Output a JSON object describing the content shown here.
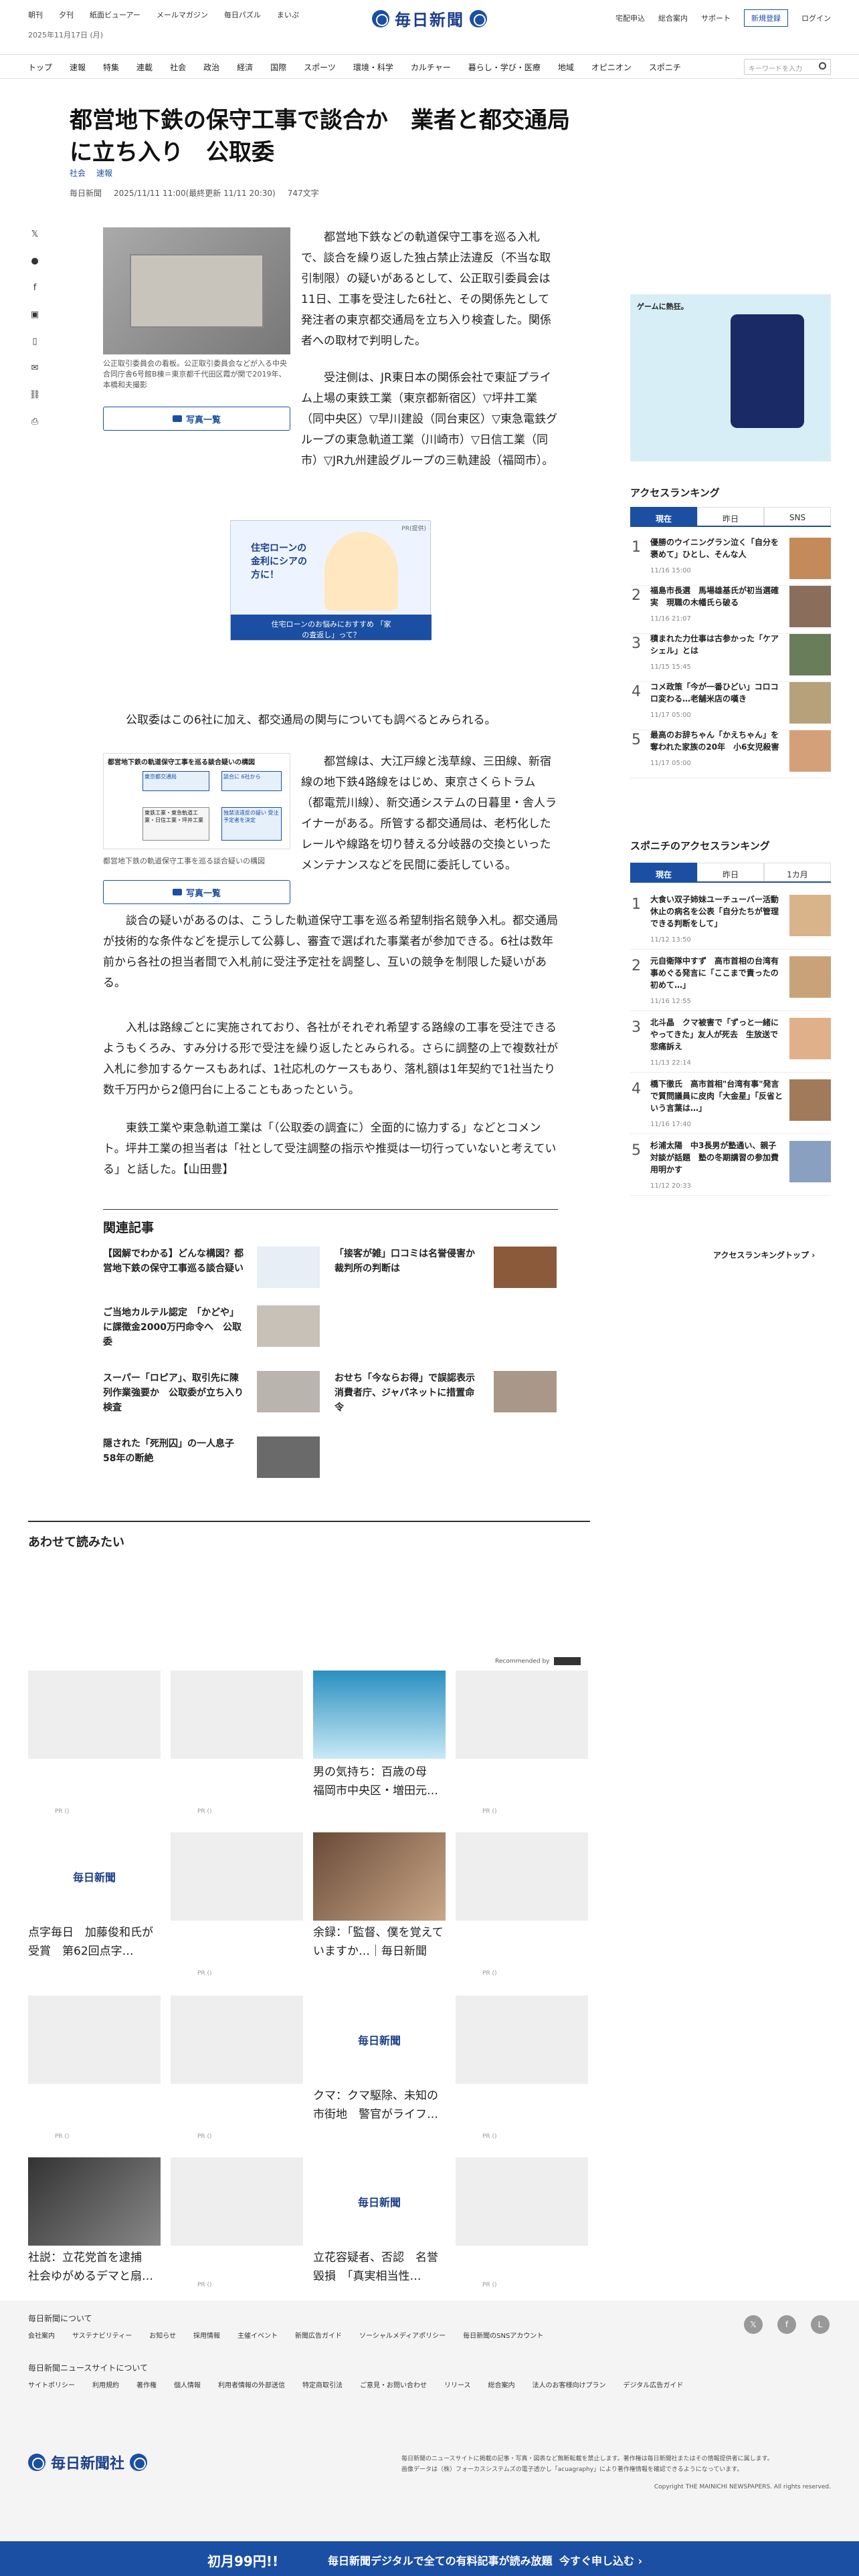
{
  "header": {
    "top_links": [
      "朝刊",
      "夕刊",
      "紙面ビューアー",
      "メールマガジン",
      "毎日パズル",
      "まいぷ"
    ],
    "date": "2025年11月17日 (月)",
    "logo_text": "毎日新聞",
    "right_links": [
      "宅配申込",
      "総合案内",
      "サポート"
    ],
    "register": "新規登録",
    "login": "ログイン"
  },
  "nav": {
    "items": [
      "トップ",
      "速報",
      "特集",
      "連載",
      "社会",
      "政治",
      "経済",
      "国際",
      "スポーツ",
      "環境・科学",
      "カルチャー",
      "暮らし・学び・医療",
      "地域",
      "オピニオン",
      "スポニチ"
    ],
    "search_placeholder": "キーワードを入力"
  },
  "article": {
    "title": "都営地下鉄の保守工事で談合か　業者と都交通局に立ち入り　公取委",
    "categories": [
      "社会",
      "速報"
    ],
    "source": "毎日新聞",
    "datetime": "2025/11/11 11:00(最終更新 11/11 20:30)",
    "chars": "747文字",
    "photo1_caption": "公正取引委員会の看板。公正取引委員会などが入る中央合同庁舎6号館B棟＝東京都千代田区霞が関で2019年、本橋和夫撮影",
    "photo_button": "写真一覧",
    "p1": "都営地下鉄などの軌道保守工事を巡る入札で、談合を繰り返した独占禁止法違反（不当な取引制限）の疑いがあるとして、公正取引委員会は11日、工事を受注した6社と、その関係先として発注者の東京都交通局を立ち入り検査した。関係者への取材で判明した。",
    "p2": "受注側は、JR東日本の関係会社で東証プライム上場の東鉄工業（東京都新宿区）▽坪井工業（同中央区）▽早川建設（同台東区）▽東急電鉄グループの東急軌道工業（川崎市）▽日信工業（同市）▽JR九州建設グループの三軌建設（福岡市）。",
    "promo_label": "PR(提供)",
    "promo_text": "住宅ローンの金利にシアの方に！",
    "promo_caption": "住宅ローンのお悩みにおすすめ 「家の査返し」って？",
    "p3": "公取委はこの6社に加え、都交通局の関与についても調べるとみられる。",
    "diagram_title": "都営地下鉄の軌道保守工事を巡る談合疑いの構図",
    "diagram_boxes": [
      "東京都交通局",
      "談合に 6社から",
      "東鉄工業・東急軌道工業・日信工業・坪井工業",
      "独禁法違反の疑い 受注予定者を決定"
    ],
    "photo2_caption": "都営地下鉄の軌道保守工事を巡る談合疑いの構図",
    "p4": "都営線は、大江戸線と浅草線、三田線、新宿線の地下鉄4路線をはじめ、東京さくらトラム（都電荒川線）、新交通システムの日暮里・舎人ライナーがある。所管する都交通局は、老朽化したレールや線路を切り替える分岐器の交換といったメンテナンスなどを民間に委託している。",
    "p5": "談合の疑いがあるのは、こうした軌道保守工事を巡る希望制指名競争入札。都交通局が技術的な条件などを提示して公募し、審査で選ばれた事業者が参加できる。6社は数年前から各社の担当者間で入札前に受注予定社を調整し、互いの競争を制限した疑いがある。",
    "p6": "入札は路線ごとに実施されており、各社がそれぞれ希望する路線の工事を受注できるようもくろみ、すみ分ける形で受注を繰り返したとみられる。さらに調整の上で複数社が入札に参加するケースもあれば、1社応札のケースもあり、落札額は1年契約で1社当たり数千万円から2億円台に上ることもあったという。",
    "p7": "東鉄工業や東急軌道工業は「（公取委の調査に）全面的に協力する」などとコメント。坪井工業の担当者は「社として受注調整の指示や推奨は一切行っていないと考えている」と話した。【山田豊】"
  },
  "related": {
    "heading": "関連記事",
    "items": [
      "【図解でわかる】どんな構図？都営地下鉄の保守工事巡る談合疑い",
      "「接客が雑」口コミは名誉侵害か　裁判所の判断は",
      "ご当地カルテル認定　「かどや」に課徴金2000万円命令へ　公取委",
      "スーパー「ロピア」、取引先に陳列作業強要か　公取委が立ち入り検査",
      "おせち「今ならお得」で誤認表示　消費者庁、ジャパネットに措置命令",
      "隠された「死刑囚」の一人息子　58年の断絶"
    ]
  },
  "recommend": {
    "heading": "あわせて読みたい",
    "recommended_by": "Recommended by",
    "pr": "PR ()",
    "titles": [
      "男の気持ち：百歳の母　福岡市中央区・増田元…",
      "点字毎日　加藤俊和氏が受賞　第62回点字…",
      "余録：「監督、僕を覚えていますか…｜毎日新聞",
      "クマ：クマ駆除、未知の市街地　警官がライフ…",
      "社説：立花党首を逮捕　社会ゆがめるデマと扇…",
      "立花容疑者、否認　名誉毀損　「真実相当性…"
    ]
  },
  "sidebar": {
    "ad_text": "ゲームに熱狂。",
    "access_ranking": "アクセスランキング",
    "tabs1": [
      "現在",
      "昨日",
      "SNS"
    ],
    "ranking1": [
      {
        "n": "1",
        "t": "優勝のウイニングラン泣く「自分を褒めて」ひとし、そんな人",
        "time": "11/16 15:00"
      },
      {
        "n": "2",
        "t": "福島市長選　馬場雄基氏が初当選確実　現職の木幡氏ら破る",
        "time": "11/16 21:07"
      },
      {
        "n": "3",
        "t": "積まれた力仕事は古参かった「ケアシェル」とは",
        "time": "11/15 15:45"
      },
      {
        "n": "4",
        "t": "コメ政策「今が一番ひどい」コロコロ変わる…老舗米店の嘆き",
        "time": "11/17 05:00"
      },
      {
        "n": "5",
        "t": "最高のお辞ちゃん「かえちゃん」を奪われた家族の20年　小6女児殺害",
        "time": "11/17 05:00"
      }
    ],
    "sponichi_ranking": "スポニチのアクセスランキング",
    "tabs2": [
      "現在",
      "昨日",
      "1カ月"
    ],
    "ranking2": [
      {
        "n": "1",
        "t": "大食い双子姉妹ユーチューバー活動休止の病名を公表「自分たちが管理できる判断をして」",
        "time": "11/12 13:50"
      },
      {
        "n": "2",
        "t": "元自衛隊中すず　高市首相の台湾有事めぐる発言に「ここまで責ったの初めて…」",
        "time": "11/16 12:55"
      },
      {
        "n": "3",
        "t": "北斗晶　クマ被害で「ずっと一緒にやってきた」友人が死去　生放送で悲痛訴え",
        "time": "11/13 22:14"
      },
      {
        "n": "4",
        "t": "橋下徹氏　高市首相\"台湾有事\"発言で質問議員に皮肉「大金星」「反省という言葉は…」",
        "time": "11/16 17:40"
      },
      {
        "n": "5",
        "t": "杉浦太陽　中3長男が塾通い、親子対談が話題　塾の冬期講習の参加費用明かす",
        "time": "11/12 20:33"
      }
    ],
    "more": "アクセスランキングトップ"
  },
  "footer": {
    "about_site": "毎日新聞について",
    "links1": [
      "会社案内",
      "サステナビリティー",
      "お知らせ",
      "採用情報",
      "主催イベント",
      "新聞広告ガイド",
      "ソーシャルメディアポリシー",
      "毎日新聞のSNSアカウント"
    ],
    "about_news": "毎日新聞ニュースサイトについて",
    "links2": [
      "サイトポリシー",
      "利用規約",
      "著作権",
      "個人情報",
      "利用者情報の外部送信",
      "特定商取引法",
      "ご意見・お問い合わせ",
      "リリース",
      "総合案内",
      "法人のお客様向けプラン",
      "デジタル広告ガイド"
    ],
    "company": "毎日新聞社",
    "notice": "毎日新聞のニュースサイトに掲載の記事・写真・図表など無断転載を禁止します。著作権は毎日新聞社またはその情報提供者に属します。",
    "notice2": "画像データは（株）フォーカスシステムズの電子透かし「acuagraphy」により著作権情報を確認できるようになっています。",
    "copyright": "Copyright THE MAINICHI NEWSPAPERS. All rights reserved.",
    "banner_left": "初月99円!!",
    "banner_mid": "毎日新聞デジタルで全ての有料記事が読み放題",
    "banner_right": "今すぐ申し込む"
  }
}
